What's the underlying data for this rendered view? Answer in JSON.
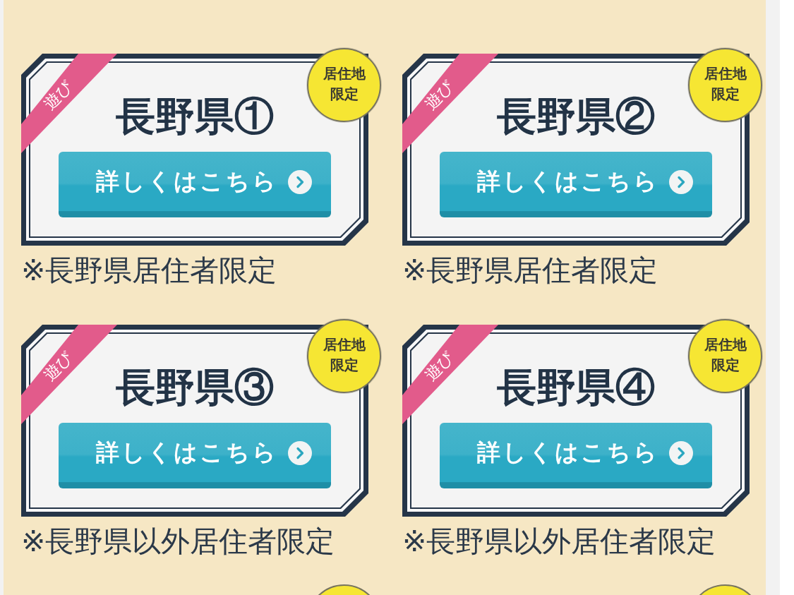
{
  "cards": [
    {
      "kind": "full",
      "category": "遊び",
      "badge": "居住地限定",
      "title": "長野県①",
      "button": "詳しくはこちら",
      "note": "※長野県居住者限定"
    },
    {
      "kind": "full",
      "category": "遊び",
      "badge": "居住地限定",
      "title": "長野県②",
      "button": "詳しくはこちら",
      "note": "※長野県居住者限定"
    },
    {
      "kind": "full",
      "category": "遊び",
      "badge": "居住地限定",
      "title": "長野県③",
      "button": "詳しくはこちら",
      "note": "※長野県以外居住者限定"
    },
    {
      "kind": "full",
      "category": "遊び",
      "badge": "居住地限定",
      "title": "長野県④",
      "button": "詳しくはこちら",
      "note": "※長野県以外居住者限定"
    },
    {
      "kind": "cut_off"
    },
    {
      "kind": "cut_off"
    }
  ]
}
